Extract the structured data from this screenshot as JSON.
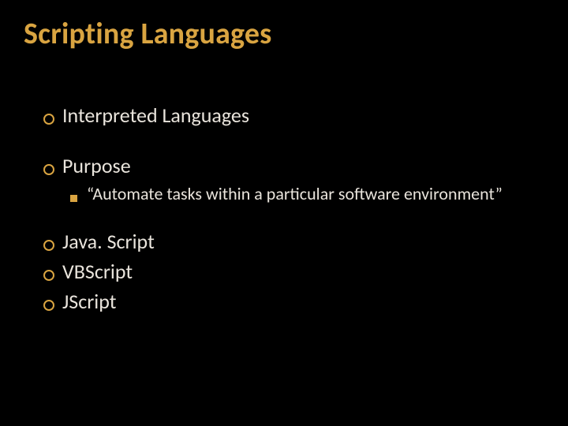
{
  "title": "Scripting Languages",
  "items": {
    "interpreted": "Interpreted Languages",
    "purpose": "Purpose",
    "purpose_sub": "“Automate tasks within a particular software environment”",
    "js": "Java. Script",
    "vbs": "VBScript",
    "jscript": "JScript"
  }
}
